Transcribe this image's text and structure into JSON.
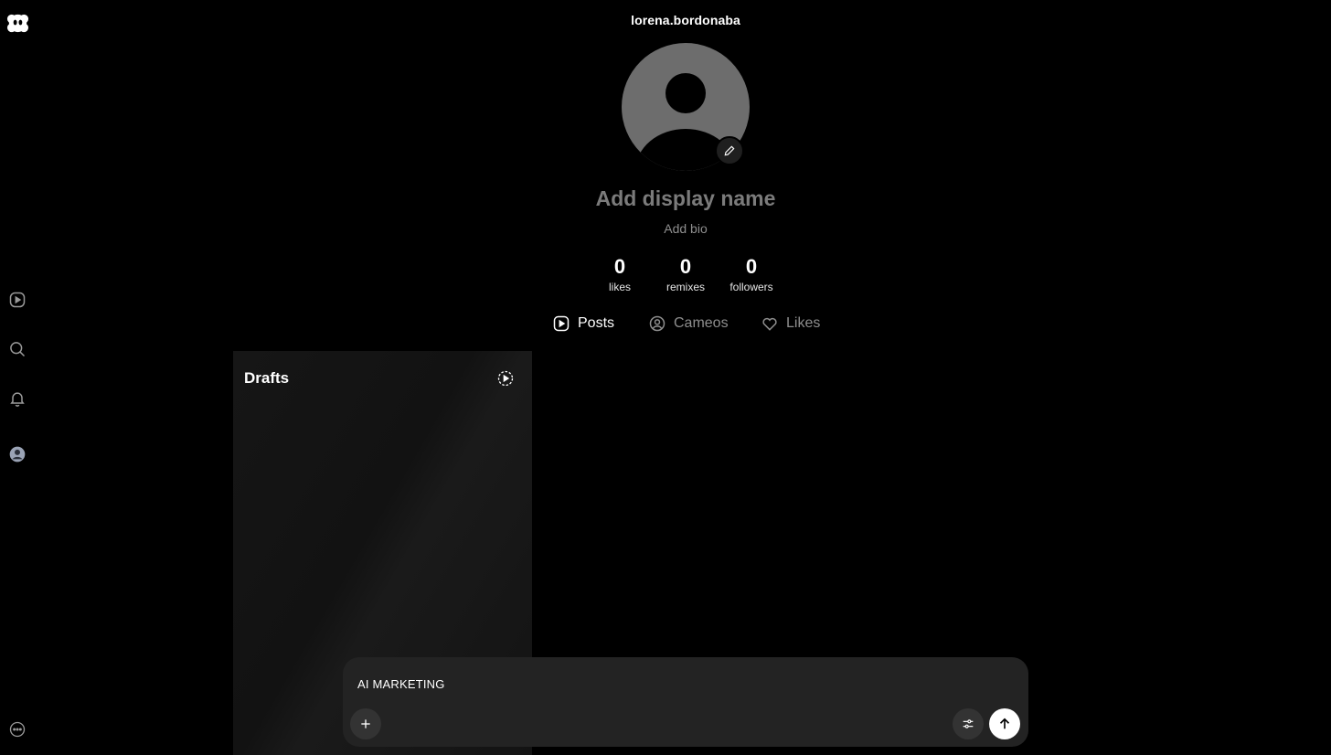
{
  "header": {
    "username": "lorena.bordonaba"
  },
  "profile": {
    "display_name_placeholder": "Add display name",
    "bio_placeholder": "Add bio"
  },
  "stats": [
    {
      "value": "0",
      "label": "likes"
    },
    {
      "value": "0",
      "label": "remixes"
    },
    {
      "value": "0",
      "label": "followers"
    }
  ],
  "tabs": [
    {
      "label": "Posts",
      "icon": "play-square-icon",
      "active": true
    },
    {
      "label": "Cameos",
      "icon": "user-circle-icon",
      "active": false
    },
    {
      "label": "Likes",
      "icon": "heart-icon",
      "active": false
    }
  ],
  "drafts": {
    "title": "Drafts"
  },
  "composer": {
    "input_value": "AI MARKETING"
  },
  "sidebar": {
    "icons": [
      "logo-icon",
      "feed-icon",
      "search-icon",
      "bell-icon",
      "profile-icon",
      "more-icon"
    ]
  }
}
